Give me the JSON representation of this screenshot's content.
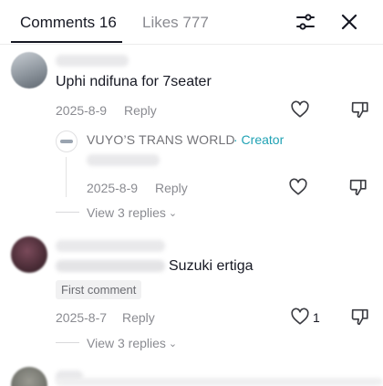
{
  "tabs": {
    "comments_label": "Comments 16",
    "likes_label": "Likes 777"
  },
  "header_icons": {
    "filter": "sliders-icon",
    "close": "close-icon"
  },
  "comments": [
    {
      "text": "Uphi ndifuna for 7seater",
      "date": "2025-8-9",
      "reply_label": "Reply",
      "likes": "",
      "replies": [
        {
          "author": "VUYO’S TRANS WORLD",
          "badge": "· Creator",
          "date": "2025-8-9",
          "reply_label": "Reply"
        }
      ],
      "view_replies_label": "View 3 replies"
    },
    {
      "text": "Suzuki ertiga",
      "badge": "First comment",
      "date": "2025-8-7",
      "reply_label": "Reply",
      "likes": "1",
      "view_replies_label": "View 3 replies"
    }
  ],
  "colors": {
    "accent": "#20a2b4",
    "muted": "#8a8b91",
    "text": "#161823"
  }
}
